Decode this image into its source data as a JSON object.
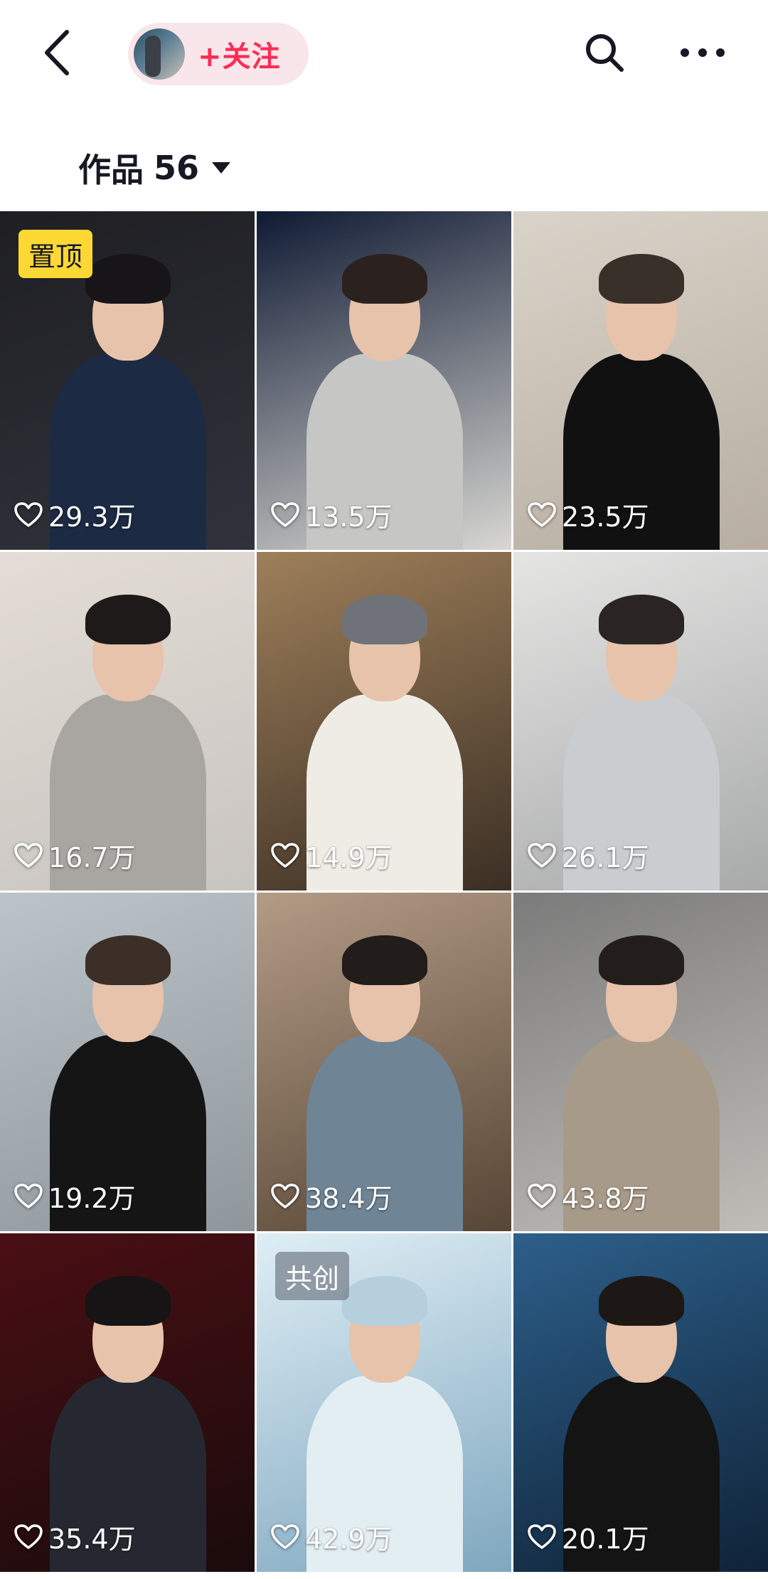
{
  "header": {
    "back_icon": "chevron-left-icon",
    "follow_label": "+关注",
    "search_icon": "search-icon",
    "more_icon": "more-horizontal-icon"
  },
  "works": {
    "label": "作品",
    "count": "56",
    "caret_icon": "caret-down-icon"
  },
  "colors": {
    "accent": "#fe2c55",
    "pin_badge": "#fdd835",
    "follow_pill_bg": "#f8e6ea"
  },
  "grid": [
    {
      "likes": "29.3万",
      "badge": "置顶",
      "badge_type": "pin",
      "bg": [
        "#1f1f23",
        "#30333c"
      ],
      "body": "#1d2a44",
      "hair": "#17151a"
    },
    {
      "likes": "13.5万",
      "badge": "",
      "badge_type": "",
      "bg": [
        "#0f1a33",
        "#d8d7d2"
      ],
      "body": "#c6c7c4",
      "hair": "#2b2220"
    },
    {
      "likes": "23.5万",
      "badge": "",
      "badge_type": "",
      "bg": [
        "#d9d3c9",
        "#b7aea1"
      ],
      "body": "#111111",
      "hair": "#3a302a"
    },
    {
      "likes": "16.7万",
      "badge": "",
      "badge_type": "",
      "bg": [
        "#e4ddd6",
        "#c8c4c0"
      ],
      "body": "#a9a6a2",
      "hair": "#1e1a19"
    },
    {
      "likes": "14.9万",
      "badge": "",
      "badge_type": "",
      "bg": [
        "#9e7f5a",
        "#3b2f24"
      ],
      "body": "#efece5",
      "hair": "#6f7278"
    },
    {
      "likes": "26.1万",
      "badge": "",
      "badge_type": "",
      "bg": [
        "#e5e5e4",
        "#a8aaa9"
      ],
      "body": "#c9cdd0",
      "hair": "#2a2524"
    },
    {
      "likes": "19.2万",
      "badge": "",
      "badge_type": "",
      "bg": [
        "#bcc3c9",
        "#8f979d"
      ],
      "body": "#151515",
      "hair": "#3b2f27"
    },
    {
      "likes": "38.4万",
      "badge": "",
      "badge_type": "",
      "bg": [
        "#b39c86",
        "#574636"
      ],
      "body": "#6f8596",
      "hair": "#221c1a"
    },
    {
      "likes": "43.8万",
      "badge": "",
      "badge_type": "",
      "bg": [
        "#7b7b7b",
        "#c0bdb8"
      ],
      "body": "#a89a88",
      "hair": "#231d1b"
    },
    {
      "likes": "35.4万",
      "badge": "",
      "badge_type": "",
      "bg": [
        "#4a0f14",
        "#1a0b0c"
      ],
      "body": "#252830",
      "hair": "#161414"
    },
    {
      "likes": "42.9万",
      "badge": "共创",
      "badge_type": "collab",
      "bg": [
        "#dfeef5",
        "#7fa7bf"
      ],
      "body": "#e3eef3",
      "hair": "#b6cfdc"
    },
    {
      "likes": "20.1万",
      "badge": "",
      "badge_type": "",
      "bg": [
        "#2d5f8a",
        "#0f2338"
      ],
      "body": "#141414",
      "hair": "#1d1816"
    }
  ]
}
